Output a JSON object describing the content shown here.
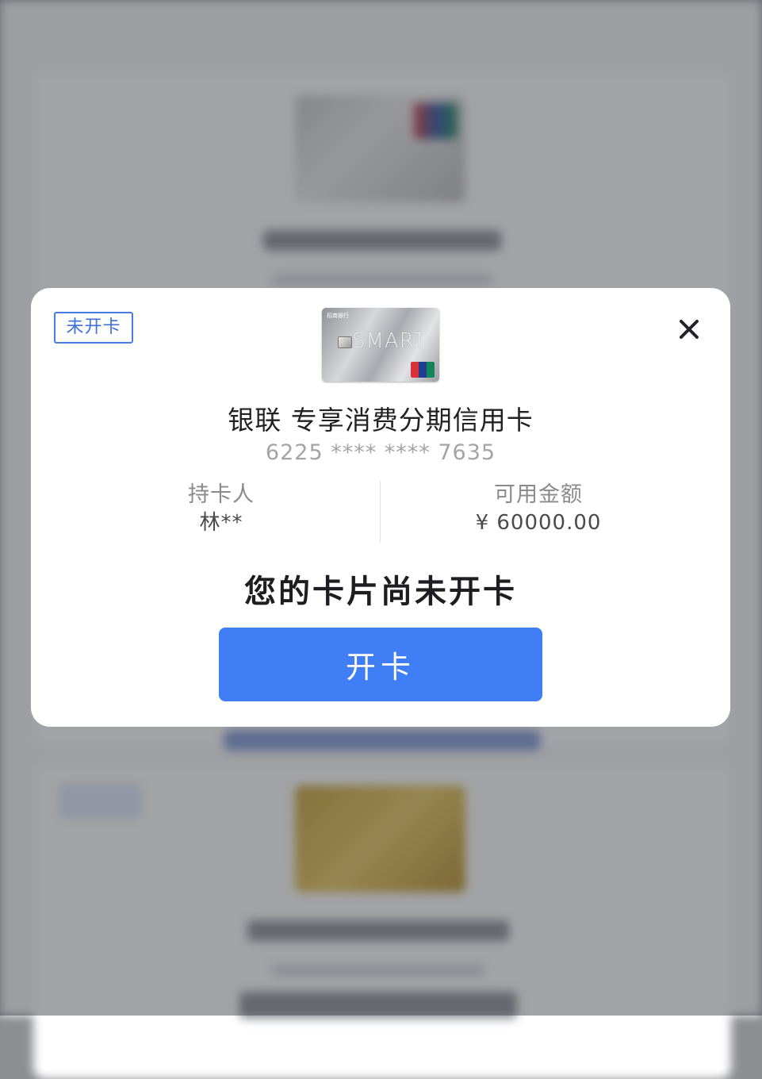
{
  "modal": {
    "status_badge": "未开卡",
    "card_image": {
      "bank_mark": "招商银行",
      "brand_text": "SMART"
    },
    "title": "银联 专享消费分期信用卡",
    "card_number": "6225 **** **** 7635",
    "holder": {
      "label": "持卡人",
      "value": "林**"
    },
    "available": {
      "label": "可用金额",
      "value": "¥ 60000.00"
    },
    "headline": "您的卡片尚未开卡",
    "activate_button": "开卡",
    "close_icon": "close-icon"
  },
  "colors": {
    "accent": "#3f7ef5",
    "badge_border": "#4a7de0",
    "overlay": "rgba(60,62,68,0.48)"
  }
}
